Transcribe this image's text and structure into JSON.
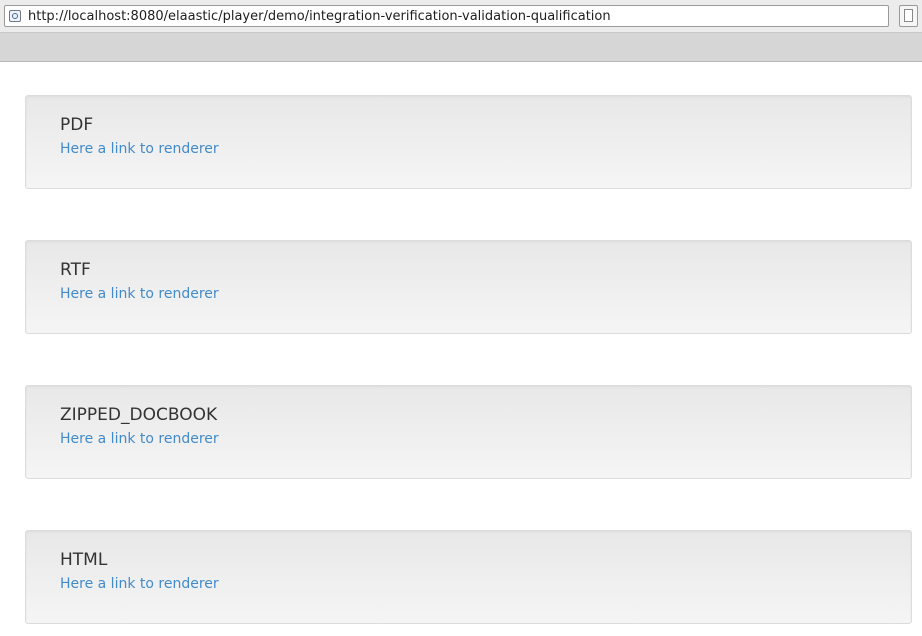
{
  "browser": {
    "url": "http://localhost:8080/elaastic/player/demo/integration-verification-validation-qualification"
  },
  "cards": [
    {
      "title": "PDF",
      "link_label": "Here a link to renderer"
    },
    {
      "title": "RTF",
      "link_label": "Here a link to renderer"
    },
    {
      "title": "ZIPPED_DOCBOOK",
      "link_label": "Here a link to renderer"
    },
    {
      "title": "HTML",
      "link_label": "Here a link to renderer"
    }
  ],
  "colors": {
    "link": "#428bca",
    "title": "#333333",
    "card_border": "#dcdcdc"
  }
}
